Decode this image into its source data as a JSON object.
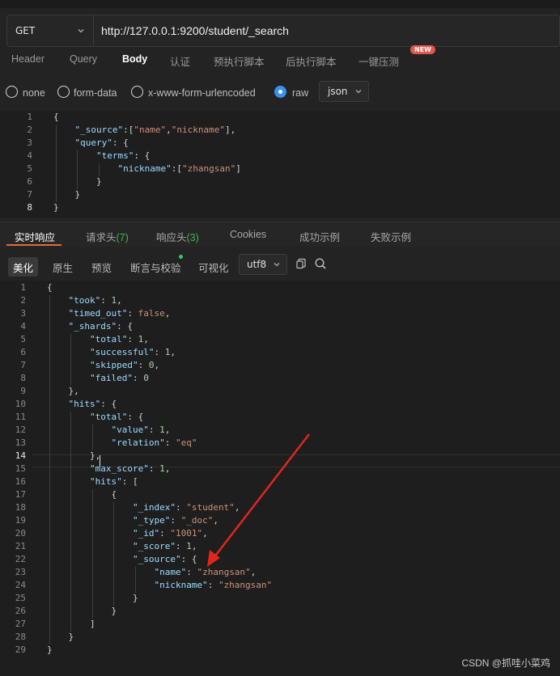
{
  "request": {
    "method": "GET",
    "url": "http://127.0.0.1:9200/student/_search"
  },
  "request_tabs": [
    "Header",
    "Query",
    "Body",
    "认证",
    "预执行脚本",
    "后执行脚本",
    "一键压测"
  ],
  "active_request_tab": "Body",
  "new_badge": "NEW",
  "body_types": {
    "options": [
      "none",
      "form-data",
      "x-www-form-urlencoded",
      "raw"
    ],
    "selected": "raw",
    "format": "json"
  },
  "request_body_lines": [
    "{",
    "    \"_source\":[\"name\",\"nickname\"],",
    "    \"query\": {",
    "        \"terms\": {",
    "            \"nickname\":[\"zhangsan\"]",
    "        }",
    "    }",
    "}"
  ],
  "request_body_current_line": 8,
  "response_tabs": [
    {
      "label": "实时响应",
      "count": ""
    },
    {
      "label": "请求头",
      "count": "(7)"
    },
    {
      "label": "响应头",
      "count": "(3)"
    },
    {
      "label": "Cookies",
      "count": ""
    },
    {
      "label": "成功示例",
      "count": ""
    },
    {
      "label": "失败示例",
      "count": ""
    }
  ],
  "view_modes": [
    "美化",
    "原生",
    "预览",
    "断言与校验",
    "可视化"
  ],
  "active_view_mode": "美化",
  "encoding": "utf8",
  "icons": [
    "copy-icon",
    "search-icon",
    "chevron-down-icon"
  ],
  "response_lines": [
    "{",
    "    \"took\": 1,",
    "    \"timed_out\": false,",
    "    \"_shards\": {",
    "        \"total\": 1,",
    "        \"successful\": 1,",
    "        \"skipped\": 0,",
    "        \"failed\": 0",
    "    },",
    "    \"hits\": {",
    "        \"total\": {",
    "            \"value\": 1,",
    "            \"relation\": \"eq\"",
    "        },",
    "        \"max_score\": 1,",
    "        \"hits\": [",
    "            {",
    "                \"_index\": \"student\",",
    "                \"_type\": \"_doc\",",
    "                \"_id\": \"1001\",",
    "                \"_score\": 1,",
    "                \"_source\": {",
    "                    \"name\": \"zhangsan\",",
    "                    \"nickname\": \"zhangsan\"",
    "                }",
    "            }",
    "        ]",
    "    }",
    "}"
  ],
  "response_current_line": 14,
  "watermark": "CSDN @抓哇小菜鸡",
  "colors": {
    "accent_tab": "#e06b3a",
    "radio_selected": "#3b8ff0",
    "count_green": "#3fb950",
    "annotation_arrow": "#e0261e",
    "json_key": "#9cdcfe",
    "json_string": "#ce9178",
    "json_number": "#b5cea8"
  }
}
